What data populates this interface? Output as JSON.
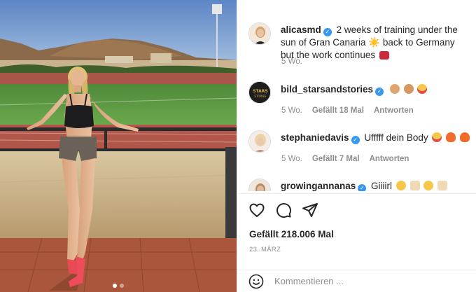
{
  "post": {
    "author": "alicasmd",
    "caption": "2 weeks of training under the sun of Gran Canaria ☀️ back to Germany but the work continues",
    "time": "5 Wo."
  },
  "comments": [
    {
      "username": "bild_starsandstories",
      "text": "",
      "time": "5 Wo.",
      "likes": "Gefällt 18 Mal",
      "reply": "Antworten",
      "emojis": [
        "clap-emoji",
        "clap-emoji",
        "heart-eyes-emoji"
      ]
    },
    {
      "username": "stephaniedavis",
      "text": "Ufffff dein Body",
      "time": "5 Wo.",
      "likes": "Gefällt 7 Mal",
      "reply": "Antworten",
      "emojis": [
        "heart-eyes-emoji",
        "fire-emoji",
        "fire-emoji"
      ]
    },
    {
      "username": "growingannanas",
      "text": "Giiiirl",
      "emojis": [
        "astonished-emoji",
        "point-left-emoji",
        "astonished-emoji",
        "point-left-emoji"
      ]
    }
  ],
  "actions": {
    "like_icon": "heart-icon",
    "comment_icon": "comment-bubble-icon",
    "share_icon": "paper-plane-icon"
  },
  "likes_label": "Gefällt 218.006 Mal",
  "date_label": "23. MÄRZ",
  "comment_input": {
    "placeholder": "Kommentieren ..."
  },
  "carousel": {
    "count": 2,
    "active": 0
  },
  "colors": {
    "verified": "#3897f0",
    "muted_text": "#8e8e8e",
    "text": "#262626",
    "divider": "#efefef"
  }
}
